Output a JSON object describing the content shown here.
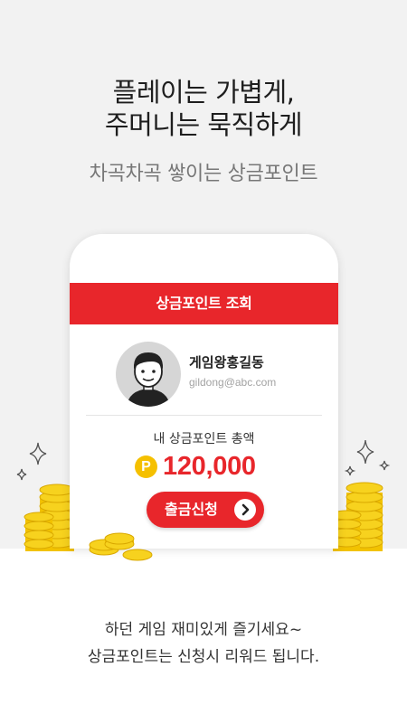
{
  "headline": {
    "line1": "플레이는 가볍게,",
    "line2": "주머니는 묵직하게"
  },
  "subheadline": "차곡차곡 쌓이는 상금포인트",
  "card": {
    "header_title": "상금포인트 조회",
    "user": {
      "name": "게임왕홍길동",
      "email": "gildong@abc.com"
    },
    "points_label": "내 상금포인트 총액",
    "points_icon": "P",
    "points_value": "120,000",
    "withdraw_button": "출금신청"
  },
  "footer": {
    "line1": "하던 게임 재미있게 즐기세요~",
    "line2": "상금포인트는 신청시 리워드 됩니다."
  },
  "colors": {
    "accent_red": "#e8262b",
    "coin_gold": "#f5c000",
    "background_gray": "#f2f2f2"
  },
  "icons": [
    "sparkle-icon",
    "coin-stack-icon",
    "user-avatar-icon",
    "point-coin-icon",
    "chevron-right-icon"
  ]
}
